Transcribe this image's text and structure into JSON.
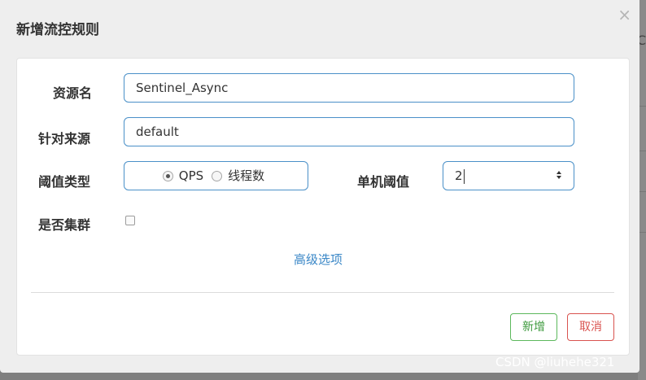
{
  "dialog": {
    "title": "新增流控规则",
    "close_glyph": "×"
  },
  "form": {
    "resource_label": "资源名",
    "resource_value": "Sentinel_Async",
    "source_label": "针对来源",
    "source_value": "default",
    "threshold_type_label": "阈值类型",
    "threshold_type_options": [
      {
        "label": "QPS",
        "checked": true
      },
      {
        "label": "线程数",
        "checked": false
      }
    ],
    "single_threshold_label": "单机阈值",
    "single_threshold_value": "2",
    "cluster_label": "是否集群",
    "cluster_checked": false,
    "advanced_link": "高级选项"
  },
  "footer": {
    "add_label": "新增",
    "cancel_label": "取消"
  },
  "watermark": "CSDN @liuhehe321",
  "backdrop_glyph": "C",
  "colors": {
    "input_border": "#4a90c8",
    "add_button": "#5cb85c",
    "cancel_button": "#d9534f",
    "link": "#3a87c7"
  }
}
